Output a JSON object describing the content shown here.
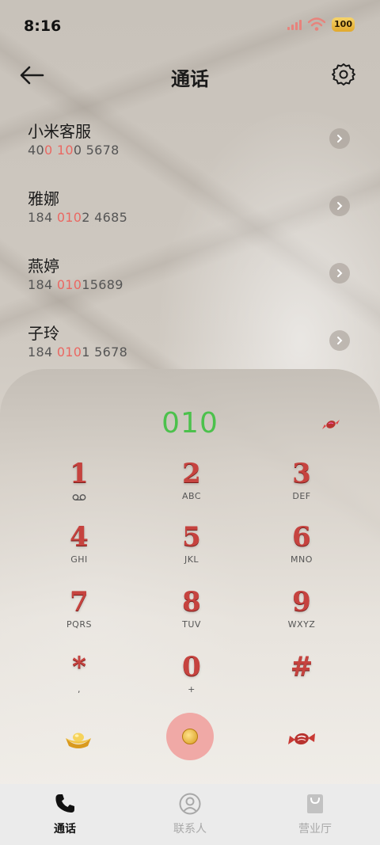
{
  "status": {
    "time": "8:16",
    "battery": "100",
    "signal_color": "#e8837c",
    "wifi_color": "#e8837c"
  },
  "header": {
    "back_icon": "arrow-left-icon",
    "title": "通话",
    "settings_icon": "gear-icon"
  },
  "contacts": [
    {
      "name": "小米客服",
      "number_parts": [
        {
          "t": "40",
          "h": false
        },
        {
          "t": "0",
          "h": true
        },
        {
          "t": " ",
          "h": false
        },
        {
          "t": "10",
          "h": true
        },
        {
          "t": "0 5678",
          "h": false
        }
      ]
    },
    {
      "name": "雅娜",
      "number_parts": [
        {
          "t": "184 ",
          "h": false
        },
        {
          "t": "010",
          "h": true
        },
        {
          "t": "2 4685",
          "h": false
        }
      ]
    },
    {
      "name": "燕婷",
      "number_parts": [
        {
          "t": "184 ",
          "h": false
        },
        {
          "t": "010",
          "h": true
        },
        {
          "t": "15689",
          "h": false
        }
      ]
    },
    {
      "name": "子玲",
      "number_parts": [
        {
          "t": "184 ",
          "h": false
        },
        {
          "t": "010",
          "h": true
        },
        {
          "t": "1 5678",
          "h": false
        }
      ]
    }
  ],
  "dialer": {
    "input_value": "010",
    "input_color": "#4cc14c",
    "keys": [
      {
        "digit": "1",
        "letters": "voicemail-icon"
      },
      {
        "digit": "2",
        "letters": "ABC"
      },
      {
        "digit": "3",
        "letters": "DEF"
      },
      {
        "digit": "4",
        "letters": "GHI"
      },
      {
        "digit": "5",
        "letters": "JKL"
      },
      {
        "digit": "6",
        "letters": "MNO"
      },
      {
        "digit": "7",
        "letters": "PQRS"
      },
      {
        "digit": "8",
        "letters": "TUV"
      },
      {
        "digit": "9",
        "letters": "WXYZ"
      },
      {
        "digit": "*",
        "letters": ","
      },
      {
        "digit": "0",
        "letters": "+"
      },
      {
        "digit": "#",
        "letters": ""
      }
    ],
    "digit_color": "#c6433f",
    "call_button_color": "#f0a9a6"
  },
  "nav": {
    "items": [
      {
        "label": "通话",
        "icon": "phone-icon",
        "active": true
      },
      {
        "label": "联系人",
        "icon": "person-icon",
        "active": false
      },
      {
        "label": "营业厅",
        "icon": "shopping-bag-icon",
        "active": false
      }
    ]
  }
}
